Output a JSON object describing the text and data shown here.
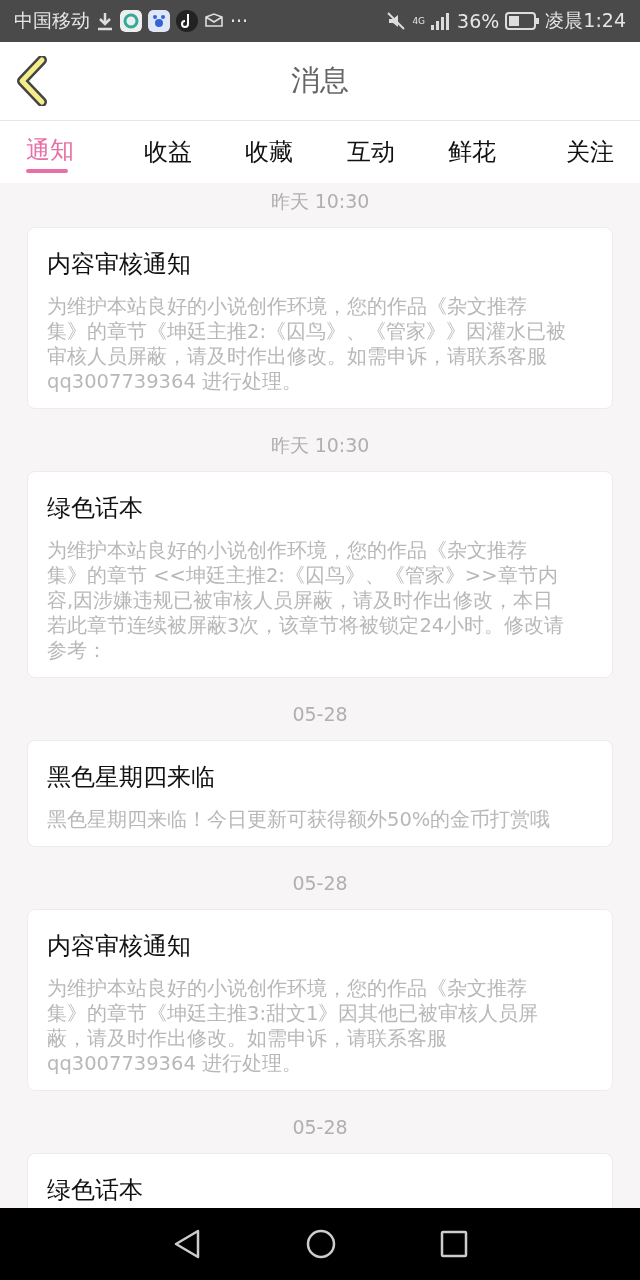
{
  "status_bar": {
    "carrier": "中国移动",
    "more": "···",
    "network": "4G",
    "battery": "36%",
    "time": "凌晨1:24"
  },
  "header": {
    "title": "消息"
  },
  "tabs": [
    {
      "label": "通知",
      "selected": true
    },
    {
      "label": "收益",
      "selected": false
    },
    {
      "label": "收藏",
      "selected": false
    },
    {
      "label": "互动",
      "selected": false
    },
    {
      "label": "鲜花",
      "selected": false
    },
    {
      "label": "关注",
      "selected": false
    }
  ],
  "messages": [
    {
      "time": "昨天 10:30",
      "title": "内容审核通知",
      "body": "为维护本站良好的小说创作环境，您的作品《杂文推荐集》的章节《坤廷主推2:《囚鸟》、《管家》》因灌水已被审核人员屏蔽，请及时作出修改。如需申诉，请联系客服qq3007739364 进行处理。"
    },
    {
      "time": "昨天 10:30",
      "title": "绿色话本",
      "body": "为维护本站良好的小说创作环境，您的作品《杂文推荐集》的章节 <<坤廷主推2:《囚鸟》、《管家》>>章节内容,因涉嫌违规已被审核人员屏蔽，请及时作出修改，本日若此章节连续被屏蔽3次，该章节将被锁定24小时。修改请参考："
    },
    {
      "time": "05-28",
      "title": "黑色星期四来临",
      "body": "黑色星期四来临！今日更新可获得额外50%的金币打赏哦"
    },
    {
      "time": "05-28",
      "title": "内容审核通知",
      "body": "为维护本站良好的小说创作环境，您的作品《杂文推荐集》的章节《坤廷主推3:甜文1》因其他已被审核人员屏蔽，请及时作出修改。如需申诉，请联系客服qq3007739364 进行处理。"
    },
    {
      "time": "05-28",
      "title": "绿色话本"
    }
  ]
}
